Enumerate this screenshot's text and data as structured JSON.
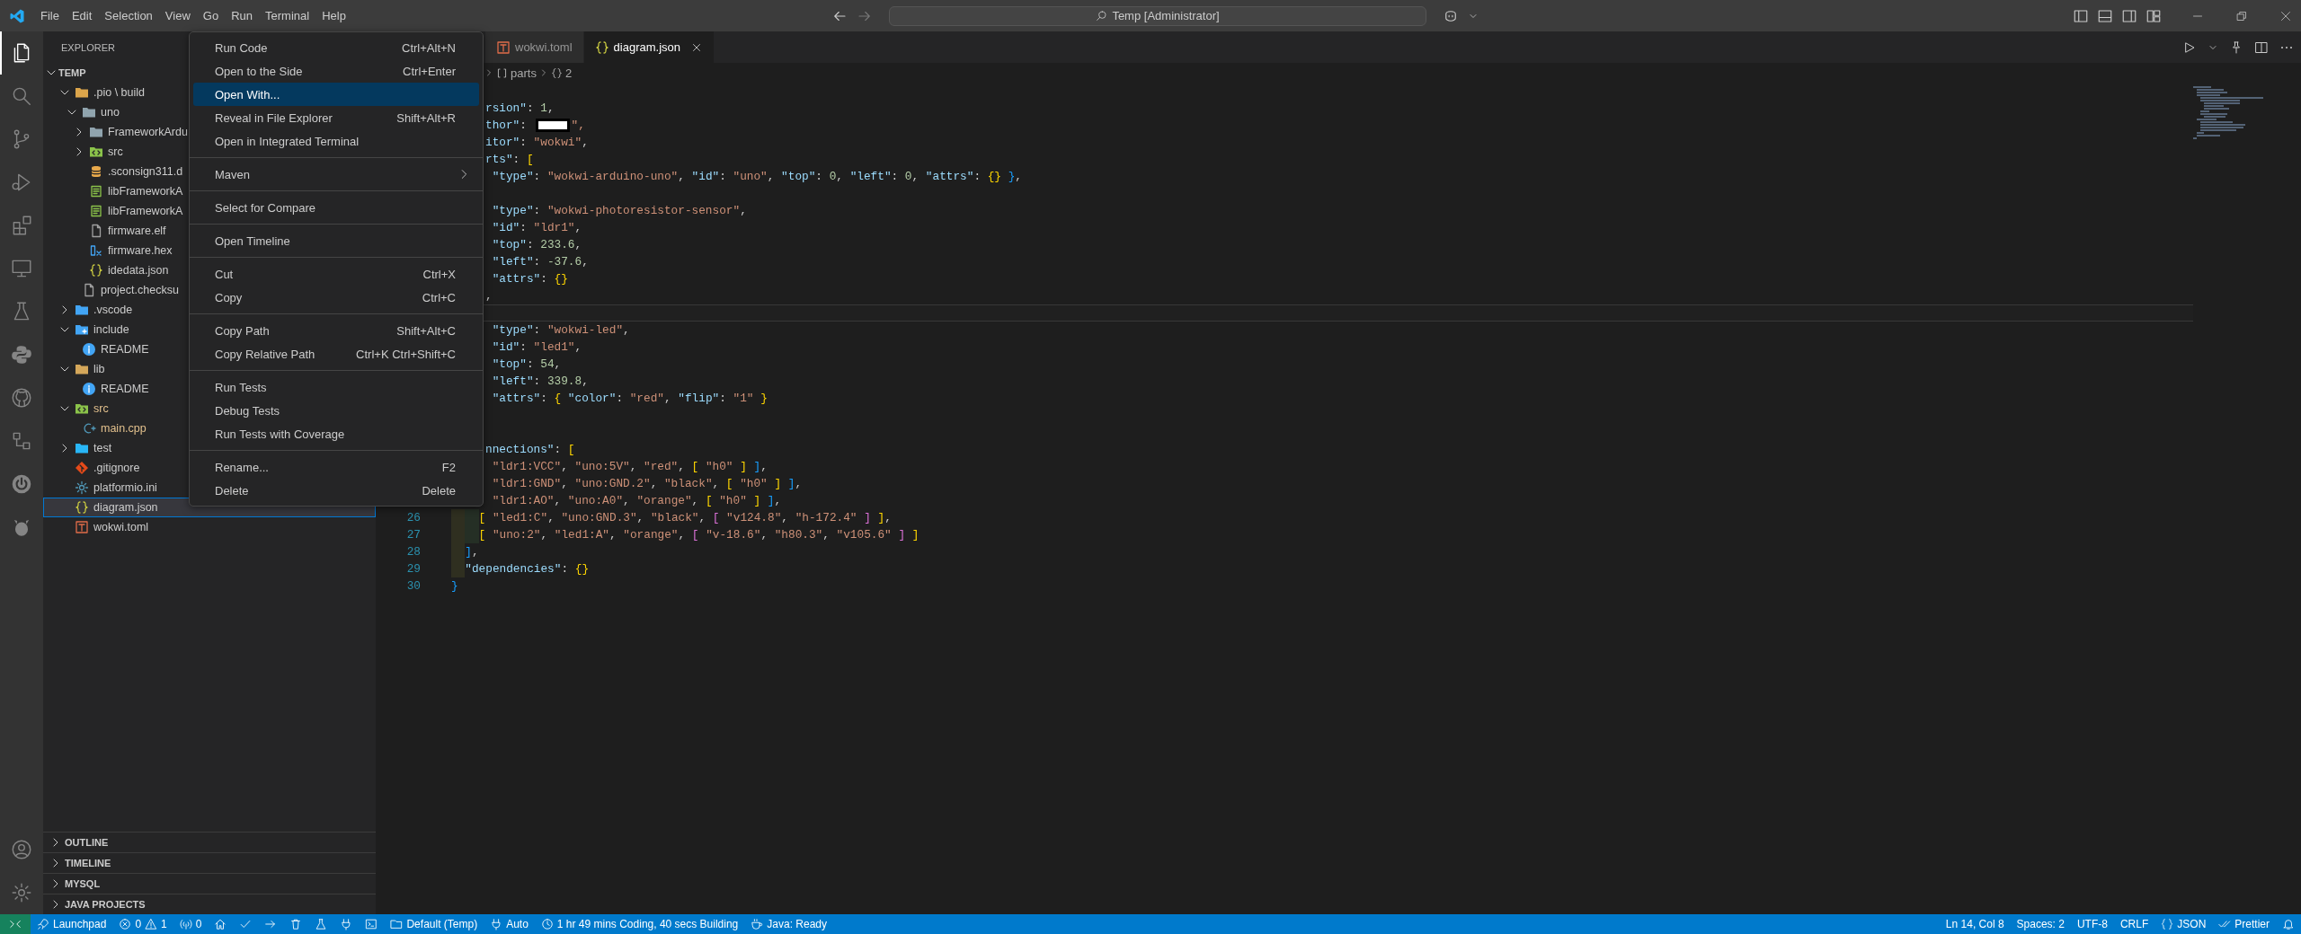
{
  "title_bar": {
    "menu": [
      "File",
      "Edit",
      "Selection",
      "View",
      "Go",
      "Run",
      "Terminal",
      "Help"
    ],
    "command_center": "Temp [Administrator]"
  },
  "activity_bar": {
    "items": [
      {
        "kind": "files",
        "selected": true
      },
      {
        "kind": "search",
        "selected": false
      },
      {
        "kind": "branch",
        "selected": false
      },
      {
        "kind": "run-debug",
        "selected": false
      },
      {
        "kind": "extensions",
        "selected": false
      },
      {
        "kind": "monitor",
        "selected": false
      },
      {
        "kind": "flask",
        "selected": false
      },
      {
        "kind": "python",
        "selected": false
      },
      {
        "kind": "github",
        "selected": false
      },
      {
        "kind": "nodes",
        "selected": false
      },
      {
        "kind": "power",
        "selected": false
      },
      {
        "kind": "ant",
        "selected": false
      }
    ],
    "bottom": [
      {
        "kind": "account"
      },
      {
        "kind": "gear"
      }
    ]
  },
  "explorer": {
    "title": "EXPLORER",
    "root": {
      "label": "TEMP",
      "expanded": true
    },
    "tree": [
      {
        "label": ".pio \\ build",
        "kind": "build-folder",
        "expanded": true,
        "modified": false,
        "selected": false,
        "children": [
          {
            "label": "uno",
            "kind": "folder",
            "expanded": true,
            "modified": false,
            "selected": false,
            "children": [
              {
                "label": "FrameworkArdu",
                "kind": "folder",
                "expanded": false,
                "modified": false,
                "selected": false
              },
              {
                "label": "src",
                "kind": "src-folder",
                "expanded": false,
                "modified": false,
                "selected": false
              },
              {
                "label": ".sconsign311.d",
                "kind": "db",
                "modified": false,
                "selected": false
              },
              {
                "label": "libFrameworkA",
                "kind": "lib",
                "modified": false,
                "selected": false
              },
              {
                "label": "libFrameworkA",
                "kind": "lib",
                "modified": false,
                "selected": false
              },
              {
                "label": "firmware.elf",
                "kind": "file",
                "modified": false,
                "selected": false
              },
              {
                "label": "firmware.hex",
                "kind": "hex",
                "modified": false,
                "selected": false
              },
              {
                "label": "idedata.json",
                "kind": "json",
                "modified": false,
                "selected": false
              }
            ]
          },
          {
            "label": "project.checksu",
            "kind": "file",
            "modified": false,
            "selected": false
          }
        ]
      },
      {
        "label": ".vscode",
        "kind": "vscode-folder",
        "expanded": false,
        "modified": false,
        "selected": false
      },
      {
        "label": "include",
        "kind": "include-folder",
        "expanded": true,
        "modified": false,
        "selected": false,
        "children": [
          {
            "label": "README",
            "kind": "info",
            "modified": false,
            "selected": false
          }
        ]
      },
      {
        "label": "lib",
        "kind": "lib-folder",
        "expanded": true,
        "modified": false,
        "selected": false,
        "children": [
          {
            "label": "README",
            "kind": "info",
            "modified": false,
            "selected": false
          }
        ]
      },
      {
        "label": "src",
        "kind": "src-folder",
        "expanded": true,
        "modified": true,
        "selected": false,
        "children": [
          {
            "label": "main.cpp",
            "kind": "cpp",
            "modified": true,
            "selected": false
          }
        ]
      },
      {
        "label": "test",
        "kind": "test-folder",
        "expanded": false,
        "modified": false,
        "selected": false
      },
      {
        "label": ".gitignore",
        "kind": "git",
        "modified": false,
        "selected": false
      },
      {
        "label": "platformio.ini",
        "kind": "gear",
        "modified": false,
        "selected": false
      },
      {
        "label": "diagram.json",
        "kind": "json",
        "modified": false,
        "selected": true
      },
      {
        "label": "wokwi.toml",
        "kind": "toml",
        "modified": false,
        "selected": false
      }
    ],
    "sections": [
      {
        "label": "OUTLINE",
        "expanded": false
      },
      {
        "label": "TIMELINE",
        "expanded": false
      },
      {
        "label": "MYSQL",
        "expanded": false
      },
      {
        "label": "JAVA PROJECTS",
        "expanded": false
      }
    ]
  },
  "editor": {
    "tabs": [
      {
        "label": "wokwi.toml",
        "kind": "toml",
        "selected": false
      },
      {
        "label": "diagram.json",
        "kind": "json",
        "selected": true
      }
    ],
    "breadcrumb": [
      {
        "kind": "array",
        "label": "parts"
      },
      {
        "kind": "object",
        "label": "2"
      }
    ],
    "lines": [
      {
        "kind": "blank",
        "current": false
      },
      {
        "kind": "code",
        "text": "rsion\": 1,",
        "current": false
      },
      {
        "kind": "redacted",
        "text": "thor\": ",
        "after": "\",",
        "current": false
      },
      {
        "kind": "code",
        "text": "itor\": \"wokwi\",",
        "current": false
      },
      {
        "kind": "code",
        "text": "rts\": [",
        "current": false
      },
      {
        "kind": "code",
        "text": " \"type\": \"wokwi-arduino-uno\", \"id\": \"uno\", \"top\": 0, \"left\": 0, \"attrs\": {} },",
        "current": false
      },
      {
        "kind": "blank",
        "current": false
      },
      {
        "kind": "code",
        "text": " \"type\": \"wokwi-photoresistor-sensor\",",
        "current": false
      },
      {
        "kind": "code",
        "text": " \"id\": \"ldr1\",",
        "current": false
      },
      {
        "kind": "code",
        "text": " \"top\": 233.6,",
        "current": false
      },
      {
        "kind": "code",
        "text": " \"left\": -37.6,",
        "current": false
      },
      {
        "kind": "code",
        "text": " \"attrs\": {}",
        "current": false
      },
      {
        "kind": "code",
        "text": ",",
        "current": false
      },
      {
        "kind": "blank",
        "current": true
      },
      {
        "kind": "code",
        "text": " \"type\": \"wokwi-led\",",
        "current": false
      },
      {
        "kind": "code",
        "text": " \"id\": \"led1\",",
        "current": false
      },
      {
        "kind": "code",
        "text": " \"top\": 54,",
        "current": false
      },
      {
        "kind": "code",
        "text": " \"left\": 339.8,",
        "current": false
      },
      {
        "kind": "code",
        "text": " \"attrs\": { \"color\": \"red\", \"flip\": \"1\" }",
        "current": false
      },
      {
        "kind": "blank",
        "current": false
      },
      {
        "kind": "blank",
        "current": false
      },
      {
        "kind": "code",
        "text": "nnections\": [",
        "current": false
      },
      {
        "kind": "code",
        "text": " \"ldr1:VCC\", \"uno:5V\", \"red\", [ \"h0\" ] ],",
        "current": false
      },
      {
        "kind": "code",
        "text": " \"ldr1:GND\", \"uno:GND.2\", \"black\", [ \"h0\" ] ],",
        "current": false
      },
      {
        "kind": "code",
        "text": " \"ldr1:AO\", \"uno:A0\", \"orange\", [ \"h0\" ] ],",
        "current": false
      },
      {
        "kind": "code",
        "number": "26",
        "text": "    [ \"led1:C\", \"uno:GND.3\", \"black\", [ \"v124.8\", \"h-172.4\" ] ],",
        "current": false
      },
      {
        "kind": "code",
        "number": "27",
        "text": "    [ \"uno:2\", \"led1:A\", \"orange\", [ \"v-18.6\", \"h80.3\", \"v105.6\" ] ]",
        "current": false
      },
      {
        "kind": "code",
        "number": "28",
        "text": "  ],",
        "current": false
      },
      {
        "kind": "code",
        "number": "29",
        "text": "  \"dependencies\": {}",
        "current": false
      },
      {
        "kind": "code",
        "number": "30",
        "text": "}",
        "current": false
      }
    ]
  },
  "context_menu": {
    "groups": [
      {
        "items": [
          {
            "kind": "command",
            "label": "Run Code",
            "shortcut": "Ctrl+Alt+N",
            "selected": false
          },
          {
            "kind": "command",
            "label": "Open to the Side",
            "shortcut": "Ctrl+Enter",
            "selected": false
          },
          {
            "kind": "command",
            "label": "Open With...",
            "selected": true
          },
          {
            "kind": "command",
            "label": "Reveal in File Explorer",
            "shortcut": "Shift+Alt+R",
            "selected": false
          },
          {
            "kind": "command",
            "label": "Open in Integrated Terminal",
            "selected": false
          }
        ]
      },
      {
        "items": [
          {
            "kind": "submenu",
            "label": "Maven",
            "selected": false
          }
        ]
      },
      {
        "items": [
          {
            "kind": "command",
            "label": "Select for Compare",
            "selected": false
          }
        ]
      },
      {
        "items": [
          {
            "kind": "command",
            "label": "Open Timeline",
            "selected": false
          }
        ]
      },
      {
        "items": [
          {
            "kind": "command",
            "label": "Cut",
            "shortcut": "Ctrl+X",
            "selected": false
          },
          {
            "kind": "command",
            "label": "Copy",
            "shortcut": "Ctrl+C",
            "selected": false
          }
        ]
      },
      {
        "items": [
          {
            "kind": "command",
            "label": "Copy Path",
            "shortcut": "Shift+Alt+C",
            "selected": false
          },
          {
            "kind": "command",
            "label": "Copy Relative Path",
            "shortcut": "Ctrl+K Ctrl+Shift+C",
            "selected": false
          }
        ]
      },
      {
        "items": [
          {
            "kind": "command",
            "label": "Run Tests",
            "selected": false
          },
          {
            "kind": "command",
            "label": "Debug Tests",
            "selected": false
          },
          {
            "kind": "command",
            "label": "Run Tests with Coverage",
            "selected": false
          }
        ]
      },
      {
        "items": [
          {
            "kind": "command",
            "label": "Rename...",
            "shortcut": "F2",
            "selected": false
          },
          {
            "kind": "command",
            "label": "Delete",
            "shortcut": "Delete",
            "selected": false
          }
        ]
      }
    ]
  },
  "status_bar": {
    "left": [
      {
        "kind": "remote"
      },
      {
        "kind": "launchpad",
        "text": "Launchpad"
      },
      {
        "kind": "problems",
        "errors": "0",
        "warnings": "1"
      },
      {
        "kind": "ports",
        "text": "0"
      },
      {
        "kind": "home"
      },
      {
        "kind": "check"
      },
      {
        "kind": "arrow"
      },
      {
        "kind": "trash"
      },
      {
        "kind": "flask"
      },
      {
        "kind": "plug"
      },
      {
        "kind": "terminal"
      },
      {
        "kind": "folder",
        "text": "Default (Temp)"
      },
      {
        "kind": "plug",
        "text": "Auto"
      },
      {
        "kind": "clock",
        "text": "1 hr 49 mins Coding, 40 secs Building"
      },
      {
        "kind": "coffee",
        "text": "Java: Ready"
      }
    ],
    "right": [
      {
        "kind": "text",
        "text": "Ln 14, Col 8"
      },
      {
        "kind": "text",
        "text": "Spaces: 2"
      },
      {
        "kind": "text",
        "text": "UTF-8"
      },
      {
        "kind": "text",
        "text": "CRLF"
      },
      {
        "kind": "braces",
        "text": "JSON"
      },
      {
        "kind": "checks",
        "text": "Prettier"
      },
      {
        "kind": "bell"
      }
    ]
  }
}
